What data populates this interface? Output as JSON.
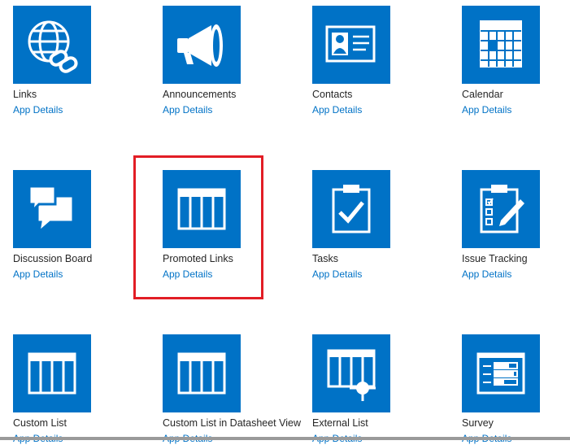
{
  "tiles": [
    {
      "name": "Links",
      "details": "App Details",
      "icon": "globe-link-icon"
    },
    {
      "name": "Announcements",
      "details": "App Details",
      "icon": "megaphone-icon"
    },
    {
      "name": "Contacts",
      "details": "App Details",
      "icon": "contact-card-icon"
    },
    {
      "name": "Calendar",
      "details": "App Details",
      "icon": "calendar-icon"
    },
    {
      "name": "Discussion Board",
      "details": "App Details",
      "icon": "speech-bubbles-icon"
    },
    {
      "name": "Promoted Links",
      "details": "App Details",
      "icon": "promoted-links-icon"
    },
    {
      "name": "Tasks",
      "details": "App Details",
      "icon": "clipboard-check-icon"
    },
    {
      "name": "Issue Tracking",
      "details": "App Details",
      "icon": "clipboard-pencil-icon"
    },
    {
      "name": "Custom List",
      "details": "App Details",
      "icon": "list-table-icon"
    },
    {
      "name": "Custom List in Datasheet View",
      "details": "App Details",
      "icon": "datasheet-table-icon"
    },
    {
      "name": "External List",
      "details": "App Details",
      "icon": "external-list-icon"
    },
    {
      "name": "Survey",
      "details": "App Details",
      "icon": "survey-icon"
    }
  ],
  "highlighted_tile": "Promoted Links",
  "colors": {
    "tile": "#0072c6",
    "link": "#0072c6",
    "text": "#262626",
    "highlight": "#e21d25"
  }
}
